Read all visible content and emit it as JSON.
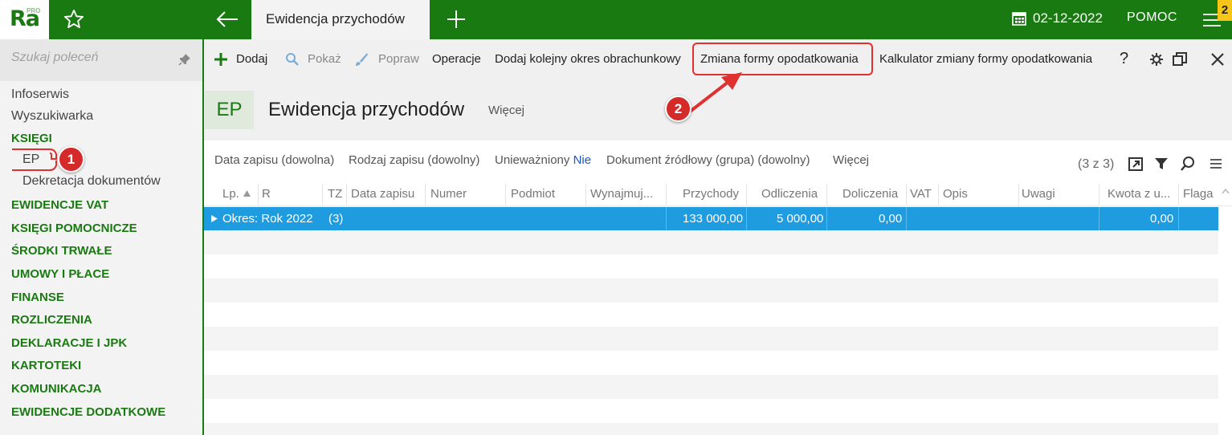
{
  "app": {
    "logo_text": "Ra",
    "logo_badge": "PRO",
    "active_tab": "Ewidencja przychodów",
    "date": "02-12-2022",
    "help_label": "POMOC",
    "notification_count": "2"
  },
  "sidebar": {
    "search_placeholder": "Szukaj poleceń",
    "items": [
      {
        "label": "Infoserwis"
      },
      {
        "label": "Wyszukiwarka"
      }
    ],
    "sections": [
      {
        "label": "KSIĘGI"
      },
      {
        "label": "EWIDENCJE VAT"
      },
      {
        "label": "KSIĘGI POMOCNICZE"
      },
      {
        "label": "ŚRODKI TRWAŁE"
      },
      {
        "label": "UMOWY I PŁACE"
      },
      {
        "label": "FINANSE"
      },
      {
        "label": "ROZLICZENIA"
      },
      {
        "label": "DEKLARACJE I JPK"
      },
      {
        "label": "KARTOTEKI"
      },
      {
        "label": "KOMUNIKACJA"
      },
      {
        "label": "EWIDENCJE DODATKOWE"
      }
    ],
    "sub_items": [
      {
        "label": "EP"
      },
      {
        "label": "Dekretacja dokumentów"
      }
    ]
  },
  "toolbar": {
    "add": "Dodaj",
    "show": "Pokaż",
    "edit": "Popraw",
    "operations": "Operacje",
    "add_period": "Dodaj kolejny okres obrachunkowy",
    "change_tax_form": "Zmiana formy opodatkowania",
    "calculator": "Kalkulator zmiany formy opodatkowania",
    "help": "?"
  },
  "header": {
    "tile": "EP",
    "title": "Ewidencja przychodów",
    "more": "Więcej"
  },
  "filters": {
    "date": "Data zapisu (dowolna)",
    "type": "Rodzaj zapisu (dowolny)",
    "cancelled_label": "Unieważniony",
    "cancelled_value": "Nie",
    "source_doc": "Dokument źródłowy (grupa) (dowolny)",
    "more": "Więcej",
    "count": "(3 z 3)"
  },
  "table": {
    "columns": [
      "Lp.",
      "R",
      "TZ",
      "Data zapisu",
      "Numer",
      "Podmiot",
      "Wynajmuj...",
      "Przychody",
      "Odliczenia",
      "Doliczenia",
      "VAT",
      "Opis",
      "Uwagi",
      "Kwota z u...",
      "Flaga"
    ],
    "group_row": {
      "label": "Okres: Rok 2022",
      "count": "(3)",
      "przychody": "133 000,00",
      "odliczenia": "5 000,00",
      "doliczenia": "0,00",
      "kwota": "0,00"
    }
  },
  "annotations": {
    "step1": "1",
    "step2": "2"
  },
  "colors": {
    "brand_green": "#1a7a12",
    "selection_blue": "#1f9be0",
    "annotation_red": "#d42a2a",
    "badge_yellow": "#f5c518"
  }
}
